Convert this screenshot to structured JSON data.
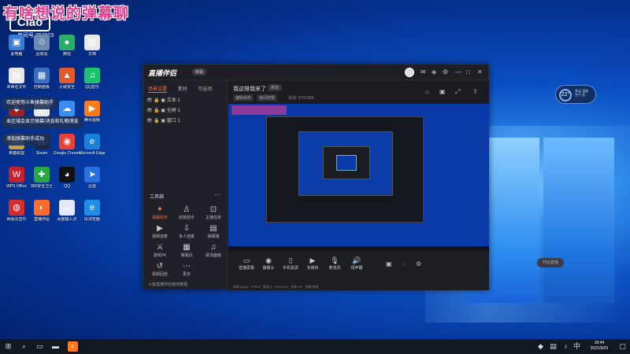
{
  "watermark": "有啥想说的弹幕聊",
  "logo_mark": "Ciao",
  "room": "房间号 767023",
  "toasts": [
    "欢迎使用斗鱼弹幕助手",
    "本区域会显示弹幕/消息和礼物消息",
    "添加弹幕助手成功"
  ],
  "desktop_icons": [
    {
      "label": "此电脑",
      "glyph": "▣",
      "color": "#3a7bd5"
    },
    {
      "label": "回收站",
      "glyph": "♲",
      "color": "#6a8ab0"
    },
    {
      "label": "微信",
      "glyph": "●",
      "color": "#2aae67"
    },
    {
      "label": "文档",
      "glyph": "▤",
      "color": "#e8e8e8"
    },
    {
      "label": "未命名文件",
      "glyph": "▤",
      "color": "#e8e8e8"
    },
    {
      "label": "控制面板",
      "glyph": "▦",
      "color": "#3a6fc0"
    },
    {
      "label": "火绒安全",
      "glyph": "▲",
      "color": "#e15a2b"
    },
    {
      "label": "QQ音乐",
      "glyph": "♫",
      "color": "#1ec26a"
    },
    {
      "label": "游戏",
      "glyph": "◆",
      "color": "#9b2222"
    },
    {
      "label": "文件",
      "glyph": "▤",
      "color": "#e8e8e8"
    },
    {
      "label": "百度网盘",
      "glyph": "☁",
      "color": "#3b8ef0"
    },
    {
      "label": "腾讯视频",
      "glyph": "▶",
      "color": "#ff7a1a"
    },
    {
      "label": "英雄联盟",
      "glyph": "◉",
      "color": "#c9a33a"
    },
    {
      "label": "Steam",
      "glyph": "◎",
      "color": "#1b2838"
    },
    {
      "label": "Google Chrome",
      "glyph": "◉",
      "color": "#e94235"
    },
    {
      "label": "Microsoft Edge",
      "glyph": "e",
      "color": "#1a7fd6"
    },
    {
      "label": "WPS Office",
      "glyph": "W",
      "color": "#c8202f"
    },
    {
      "label": "360安全卫士",
      "glyph": "✚",
      "color": "#28a745"
    },
    {
      "label": "QQ",
      "glyph": "◕",
      "color": "#111"
    },
    {
      "label": "迅雷",
      "glyph": "➤",
      "color": "#2a6fe0"
    },
    {
      "label": "网易云音乐",
      "glyph": "◍",
      "color": "#d62c2c"
    },
    {
      "label": "直播伴侣",
      "glyph": "◐",
      "color": "#ff6b2c"
    },
    {
      "label": "百度输入法",
      "glyph": "◒",
      "color": "#e6e6ff"
    },
    {
      "label": "IE浏览器",
      "glyph": "e",
      "color": "#1f8ee6"
    }
  ],
  "window": {
    "brand": "直播伴侣",
    "version": "新版",
    "left_tabs": [
      "场景设置",
      "素材",
      "可选项"
    ],
    "sources": [
      "文本 1",
      "全屏 1",
      "窗口 1"
    ],
    "tools_header": "工具箱",
    "tools": [
      "弹幕助手",
      "房管助手",
      "主播任务",
      "视频连麦",
      "多人连麦",
      "弹幕墙",
      "游戏PK",
      "弹幕机",
      "歌词面板",
      "视频回放",
      "更多"
    ],
    "left_footer": "斗鱼直播伴侣使用教程",
    "title_text": "我这根我来了",
    "title_tag": "修改",
    "badges": [
      "编辑资料",
      "房间权限"
    ],
    "meta": "在线: 9767058",
    "bottom_buttons": [
      "直播屏幕",
      "摄像头",
      "手机投屏",
      "多媒体",
      "麦克风",
      "扬声器"
    ],
    "start_button": "开始直播",
    "status": [
      "码率:0kbps",
      "FPS:0",
      "丢帧:0",
      "CPU:12%",
      "内存:2%",
      "网络:良好"
    ]
  },
  "weather": {
    "temp": "22°",
    "line1": "多云 湿度",
    "line2": "空气 良"
  },
  "clock": {
    "time": "18:44",
    "date": "2021/9/29"
  }
}
